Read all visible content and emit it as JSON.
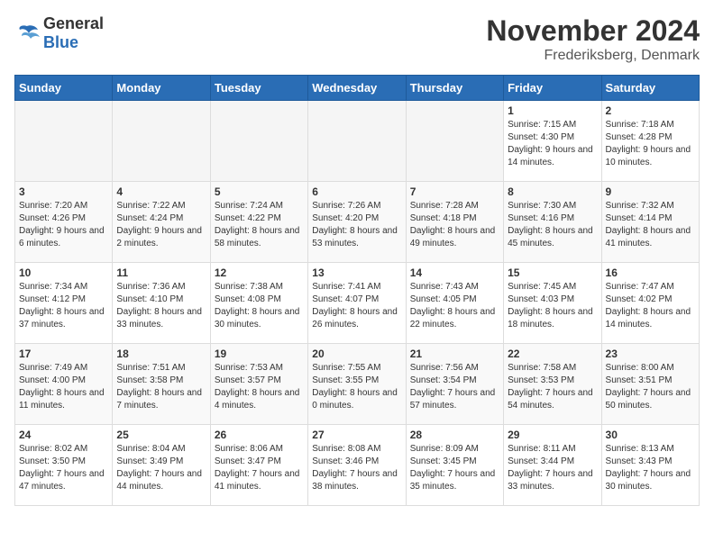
{
  "logo": {
    "general": "General",
    "blue": "Blue"
  },
  "title": "November 2024",
  "subtitle": "Frederiksberg, Denmark",
  "weekdays": [
    "Sunday",
    "Monday",
    "Tuesday",
    "Wednesday",
    "Thursday",
    "Friday",
    "Saturday"
  ],
  "weeks": [
    [
      {
        "day": "",
        "info": ""
      },
      {
        "day": "",
        "info": ""
      },
      {
        "day": "",
        "info": ""
      },
      {
        "day": "",
        "info": ""
      },
      {
        "day": "",
        "info": ""
      },
      {
        "day": "1",
        "info": "Sunrise: 7:15 AM\nSunset: 4:30 PM\nDaylight: 9 hours and 14 minutes."
      },
      {
        "day": "2",
        "info": "Sunrise: 7:18 AM\nSunset: 4:28 PM\nDaylight: 9 hours and 10 minutes."
      }
    ],
    [
      {
        "day": "3",
        "info": "Sunrise: 7:20 AM\nSunset: 4:26 PM\nDaylight: 9 hours and 6 minutes."
      },
      {
        "day": "4",
        "info": "Sunrise: 7:22 AM\nSunset: 4:24 PM\nDaylight: 9 hours and 2 minutes."
      },
      {
        "day": "5",
        "info": "Sunrise: 7:24 AM\nSunset: 4:22 PM\nDaylight: 8 hours and 58 minutes."
      },
      {
        "day": "6",
        "info": "Sunrise: 7:26 AM\nSunset: 4:20 PM\nDaylight: 8 hours and 53 minutes."
      },
      {
        "day": "7",
        "info": "Sunrise: 7:28 AM\nSunset: 4:18 PM\nDaylight: 8 hours and 49 minutes."
      },
      {
        "day": "8",
        "info": "Sunrise: 7:30 AM\nSunset: 4:16 PM\nDaylight: 8 hours and 45 minutes."
      },
      {
        "day": "9",
        "info": "Sunrise: 7:32 AM\nSunset: 4:14 PM\nDaylight: 8 hours and 41 minutes."
      }
    ],
    [
      {
        "day": "10",
        "info": "Sunrise: 7:34 AM\nSunset: 4:12 PM\nDaylight: 8 hours and 37 minutes."
      },
      {
        "day": "11",
        "info": "Sunrise: 7:36 AM\nSunset: 4:10 PM\nDaylight: 8 hours and 33 minutes."
      },
      {
        "day": "12",
        "info": "Sunrise: 7:38 AM\nSunset: 4:08 PM\nDaylight: 8 hours and 30 minutes."
      },
      {
        "day": "13",
        "info": "Sunrise: 7:41 AM\nSunset: 4:07 PM\nDaylight: 8 hours and 26 minutes."
      },
      {
        "day": "14",
        "info": "Sunrise: 7:43 AM\nSunset: 4:05 PM\nDaylight: 8 hours and 22 minutes."
      },
      {
        "day": "15",
        "info": "Sunrise: 7:45 AM\nSunset: 4:03 PM\nDaylight: 8 hours and 18 minutes."
      },
      {
        "day": "16",
        "info": "Sunrise: 7:47 AM\nSunset: 4:02 PM\nDaylight: 8 hours and 14 minutes."
      }
    ],
    [
      {
        "day": "17",
        "info": "Sunrise: 7:49 AM\nSunset: 4:00 PM\nDaylight: 8 hours and 11 minutes."
      },
      {
        "day": "18",
        "info": "Sunrise: 7:51 AM\nSunset: 3:58 PM\nDaylight: 8 hours and 7 minutes."
      },
      {
        "day": "19",
        "info": "Sunrise: 7:53 AM\nSunset: 3:57 PM\nDaylight: 8 hours and 4 minutes."
      },
      {
        "day": "20",
        "info": "Sunrise: 7:55 AM\nSunset: 3:55 PM\nDaylight: 8 hours and 0 minutes."
      },
      {
        "day": "21",
        "info": "Sunrise: 7:56 AM\nSunset: 3:54 PM\nDaylight: 7 hours and 57 minutes."
      },
      {
        "day": "22",
        "info": "Sunrise: 7:58 AM\nSunset: 3:53 PM\nDaylight: 7 hours and 54 minutes."
      },
      {
        "day": "23",
        "info": "Sunrise: 8:00 AM\nSunset: 3:51 PM\nDaylight: 7 hours and 50 minutes."
      }
    ],
    [
      {
        "day": "24",
        "info": "Sunrise: 8:02 AM\nSunset: 3:50 PM\nDaylight: 7 hours and 47 minutes."
      },
      {
        "day": "25",
        "info": "Sunrise: 8:04 AM\nSunset: 3:49 PM\nDaylight: 7 hours and 44 minutes."
      },
      {
        "day": "26",
        "info": "Sunrise: 8:06 AM\nSunset: 3:47 PM\nDaylight: 7 hours and 41 minutes."
      },
      {
        "day": "27",
        "info": "Sunrise: 8:08 AM\nSunset: 3:46 PM\nDaylight: 7 hours and 38 minutes."
      },
      {
        "day": "28",
        "info": "Sunrise: 8:09 AM\nSunset: 3:45 PM\nDaylight: 7 hours and 35 minutes."
      },
      {
        "day": "29",
        "info": "Sunrise: 8:11 AM\nSunset: 3:44 PM\nDaylight: 7 hours and 33 minutes."
      },
      {
        "day": "30",
        "info": "Sunrise: 8:13 AM\nSunset: 3:43 PM\nDaylight: 7 hours and 30 minutes."
      }
    ]
  ]
}
